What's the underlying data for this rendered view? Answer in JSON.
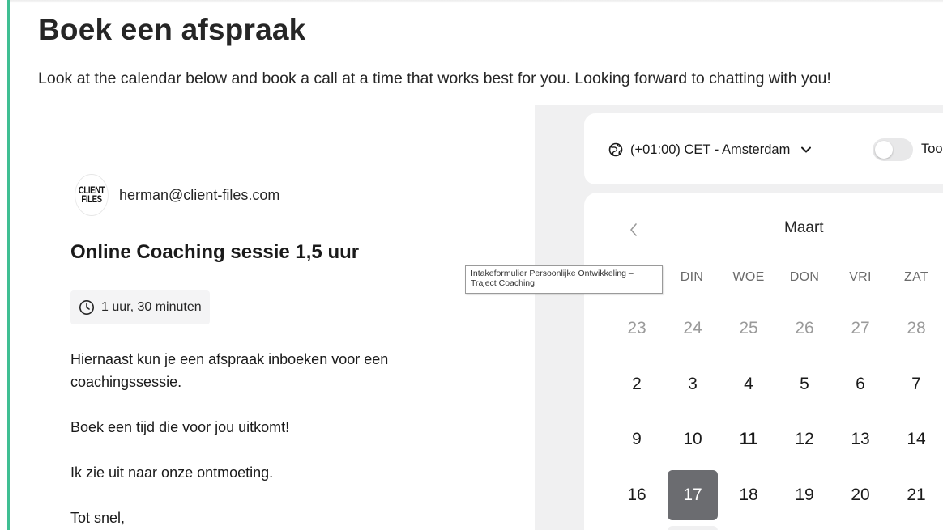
{
  "page": {
    "title": "Boek een afspraak",
    "intro": "Look at the calendar below and book a call at a time that works best for you. Looking forward to chatting with you!"
  },
  "colors": {
    "accent": "#3fbf93",
    "selected_day": "#6b6c70",
    "panel_bg": "#f0f0f1"
  },
  "host": {
    "logo_text_line1": "CLIENT",
    "logo_text_line2": "FILES",
    "email": "herman@client-files.com"
  },
  "event": {
    "title": "Online Coaching sessie 1,5 uur",
    "duration_icon": "clock-icon",
    "duration": "1 uur, 30 minuten",
    "description": [
      "Hiernaast kun je een afspraak inboeken voor een",
      "coachingssessie.",
      "Boek een tijd die voor jou uitkomt!",
      "Ik zie uit naar onze ontmoeting.",
      "Tot snel,"
    ]
  },
  "booker": {
    "timezone_icon": "globe-icon",
    "timezone": "(+01:00) CET - Amsterdam",
    "toggle_label": "Too",
    "month": "Maart",
    "weekdays": [
      "DIN",
      "WOE",
      "DON",
      "VRI",
      "ZAT"
    ],
    "weeks": [
      [
        "23",
        "24",
        "25",
        "26",
        "27",
        "28"
      ],
      [
        "2",
        "3",
        "4",
        "5",
        "6",
        "7"
      ],
      [
        "9",
        "10",
        "11",
        "12",
        "13",
        "14"
      ],
      [
        "16",
        "17",
        "18",
        "19",
        "20",
        "21"
      ]
    ],
    "today": "11",
    "selected": "17"
  },
  "tooltip": {
    "text": "Intakeformulier Persoonlijke Ontwikkeling – Traject Coaching"
  }
}
